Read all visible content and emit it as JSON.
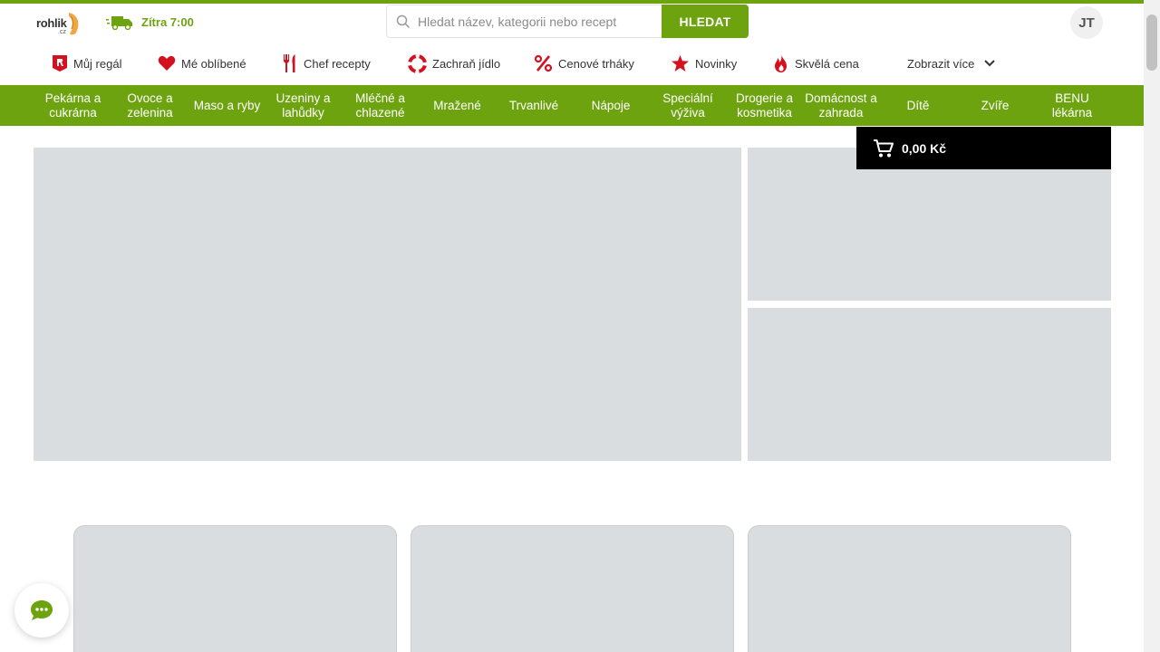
{
  "header": {
    "logo_text": "rohlik",
    "logo_sub": ".cz",
    "delivery_label": "Zítra 7:00",
    "search": {
      "placeholder": "Hledat název, kategorii nebo recept",
      "value": "",
      "button_label": "HLEDAT"
    },
    "user_initials": "JT"
  },
  "subnav": {
    "items": [
      {
        "label": "Můj regál",
        "icon": "shelf-icon"
      },
      {
        "label": "Mé oblíbené",
        "icon": "heart-icon"
      },
      {
        "label": "Chef recepty",
        "icon": "cutlery-icon"
      },
      {
        "label": "Zachraň jídlo",
        "icon": "lifebuoy-icon"
      },
      {
        "label": "Cenové trháky",
        "icon": "percent-icon"
      },
      {
        "label": "Novinky",
        "icon": "star-icon"
      },
      {
        "label": "Skvělá cena",
        "icon": "flame-icon"
      }
    ],
    "more_label": "Zobrazit více"
  },
  "categories": [
    "Pekárna a cukrárna",
    "Ovoce a zelenina",
    "Maso a ryby",
    "Uzeniny a lahůdky",
    "Mléčné a chlazené",
    "Mražené",
    "Trvanlivé",
    "Nápoje",
    "Speciální výživa",
    "Drogerie a kosmetika",
    "Domácnost a zahrada",
    "Dítě",
    "Zvíře",
    "BENU lékárna"
  ],
  "cart": {
    "total": "0,00 Kč"
  },
  "colors": {
    "brand_green": "#6da30f",
    "accent_red": "#d4111e",
    "placeholder_gray": "#dadde0"
  }
}
